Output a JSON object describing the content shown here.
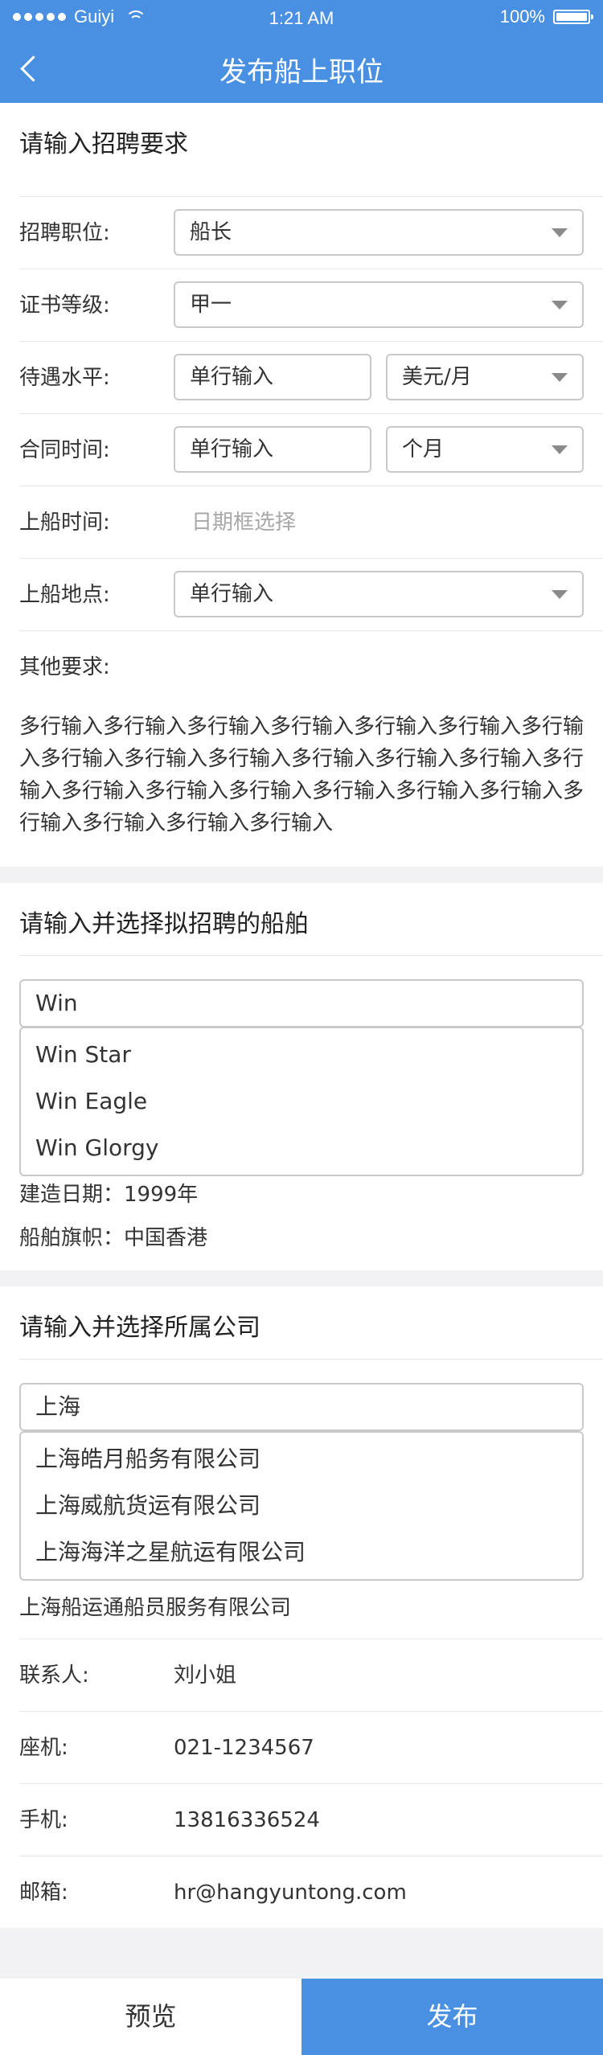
{
  "status": {
    "carrier": "Guiyi",
    "time": "1:21 AM",
    "battery": "100%"
  },
  "nav": {
    "title": "发布船上职位"
  },
  "req": {
    "title": "请输入招聘要求",
    "position_label": "招聘职位:",
    "position_value": "船长",
    "cert_label": "证书等级:",
    "cert_value": "甲一",
    "salary_label": "待遇水平:",
    "salary_value": "单行输入",
    "salary_unit": "美元/月",
    "contract_label": "合同时间:",
    "contract_value": "单行输入",
    "contract_unit": "个月",
    "board_time_label": "上船时间:",
    "board_time_placeholder": "日期框选择",
    "board_place_label": "上船地点:",
    "board_place_value": "单行输入",
    "other_label": "其他要求:",
    "other_text": "多行输入多行输入多行输入多行输入多行输入多行输入多行输入多行输入多行输入多行输入多行输入多行输入多行输入多行输入多行输入多行输入多行输入多行输入多行输入多行输入多行输入多行输入多行输入多行输入"
  },
  "ship": {
    "title": "请输入并选择拟招聘的船舶",
    "input": "Win",
    "options": [
      "Win Star",
      "Win Eagle",
      "Win Glorgy"
    ],
    "build_date": "建造日期：1999年",
    "flag": "船舶旗帜：中国香港"
  },
  "company": {
    "title": "请输入并选择所属公司",
    "input": "上海",
    "options": [
      "上海皓月船务有限公司",
      "上海威航货运有限公司",
      "上海海洋之星航运有限公司"
    ],
    "selected": "上海船运通船员服务有限公司",
    "contact_label": "联系人:",
    "contact_value": "刘小姐",
    "phone_label": "座机:",
    "phone_value": "021-1234567",
    "mobile_label": "手机:",
    "mobile_value": "13816336524",
    "email_label": "邮箱:",
    "email_value": "hr@hangyuntong.com"
  },
  "actions": {
    "preview": "预览",
    "publish": "发布"
  },
  "colors": {
    "primary": "#4a90e2"
  }
}
